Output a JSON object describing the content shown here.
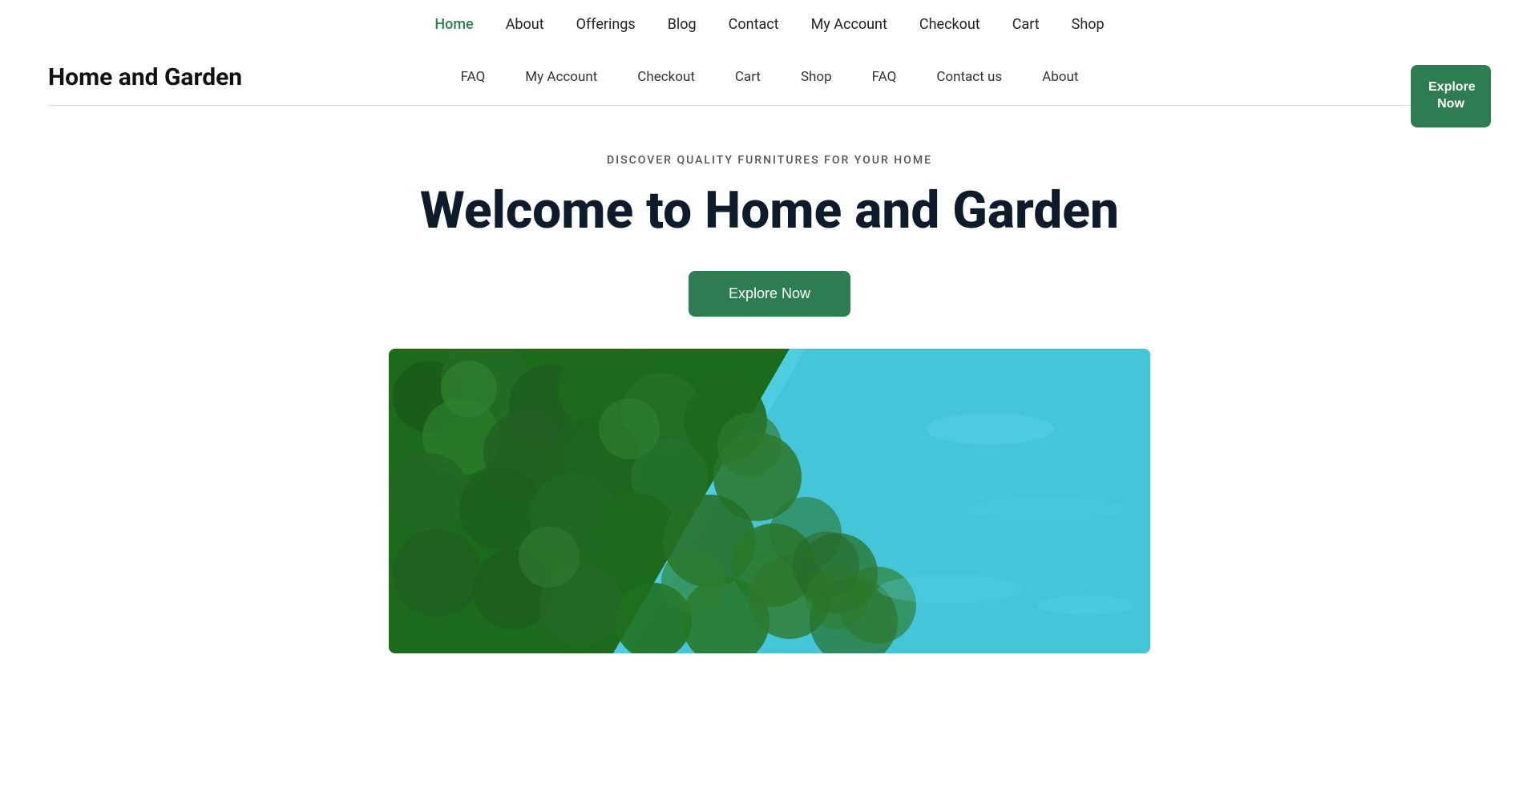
{
  "logo": {
    "text": "Home and Garden"
  },
  "top_nav": {
    "items": [
      {
        "label": "Home",
        "active": true
      },
      {
        "label": "About",
        "active": false
      },
      {
        "label": "Offerings",
        "active": false
      },
      {
        "label": "Blog",
        "active": false
      },
      {
        "label": "Contact",
        "active": false
      },
      {
        "label": "My Account",
        "active": false
      },
      {
        "label": "Checkout",
        "active": false
      },
      {
        "label": "Cart",
        "active": false
      },
      {
        "label": "Shop",
        "active": false
      }
    ]
  },
  "secondary_nav": {
    "items": [
      {
        "label": "FAQ"
      },
      {
        "label": "My Account"
      },
      {
        "label": "Checkout"
      },
      {
        "label": "Cart"
      },
      {
        "label": "Shop"
      },
      {
        "label": "FAQ"
      },
      {
        "label": "Contact us"
      },
      {
        "label": "About"
      }
    ]
  },
  "explore_corner": {
    "label": "Explore Now"
  },
  "hero": {
    "subtitle": "DISCOVER QUALITY FURNITURES FOR YOUR HOME",
    "title": "Welcome to Home and Garden",
    "cta_label": "Explore Now"
  }
}
